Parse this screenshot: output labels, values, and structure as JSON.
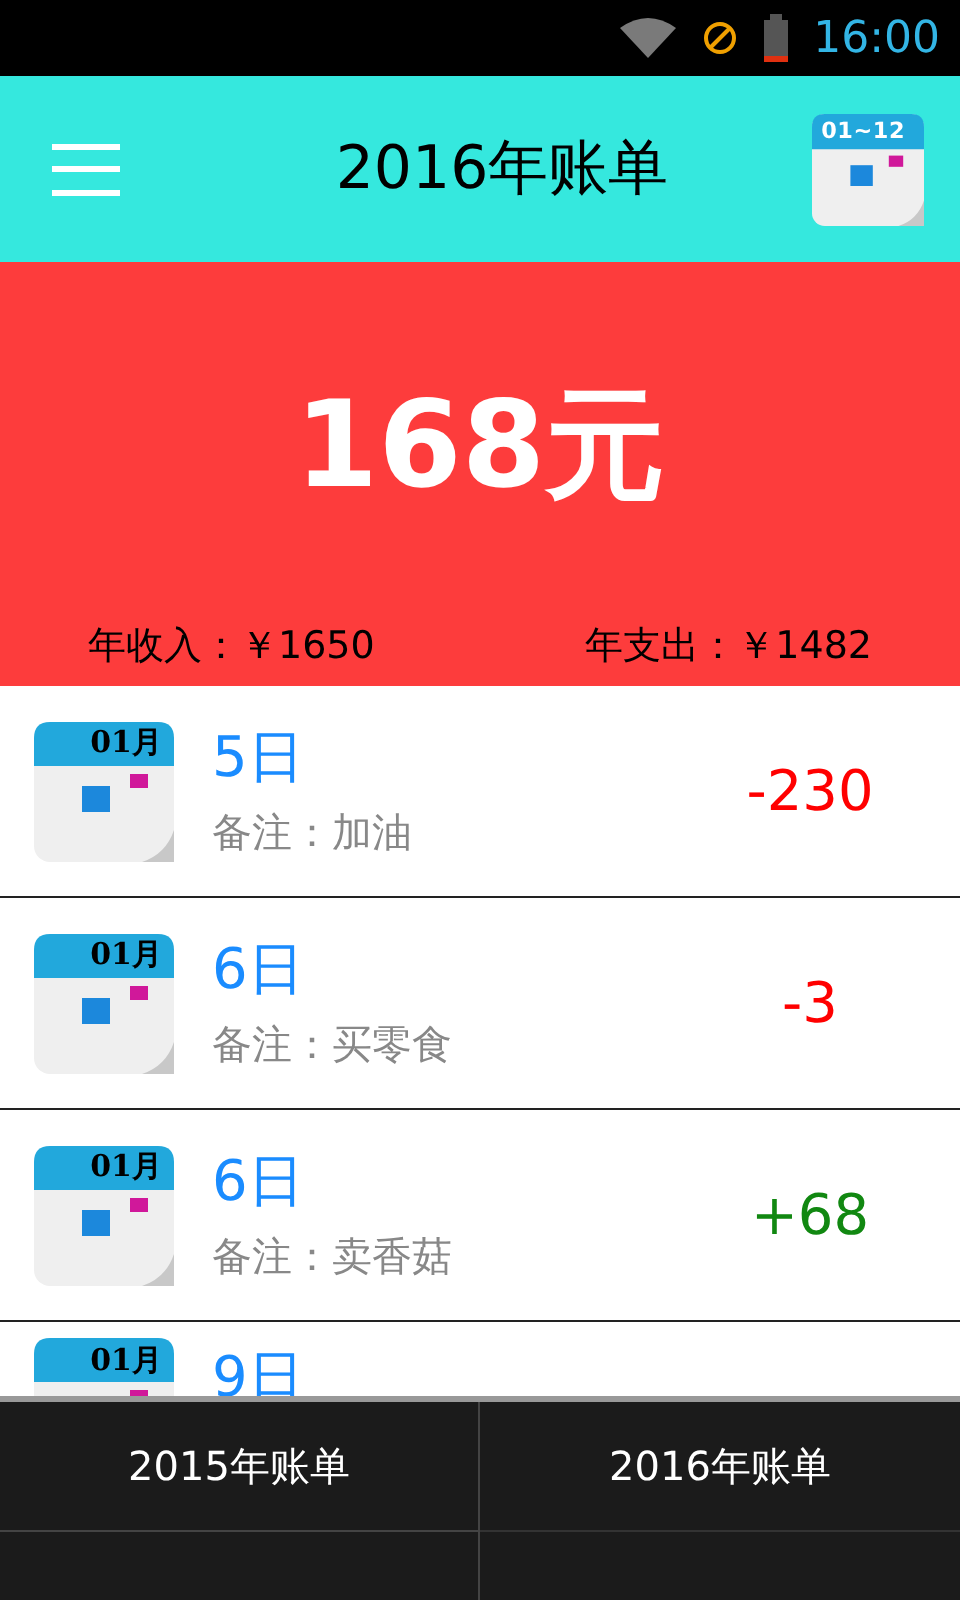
{
  "status_bar": {
    "time": "16:00"
  },
  "header": {
    "title": "2016年账单",
    "calendar_icon_label": "01~12"
  },
  "summary": {
    "balance": "168元",
    "income": "年收入：￥1650",
    "expense": "年支出：￥1482"
  },
  "entries": [
    {
      "icon_label": "01月",
      "day": "5日",
      "note": "备注：加油",
      "amount": "-230",
      "kind": "expense"
    },
    {
      "icon_label": "01月",
      "day": "6日",
      "note": "备注：买零食",
      "amount": "-3",
      "kind": "expense"
    },
    {
      "icon_label": "01月",
      "day": "6日",
      "note": "备注：卖香菇",
      "amount": "+68",
      "kind": "income"
    },
    {
      "icon_label": "01月",
      "day": "9日"
    }
  ],
  "menu": {
    "items": [
      "2015年账单",
      "2016年账单"
    ]
  }
}
